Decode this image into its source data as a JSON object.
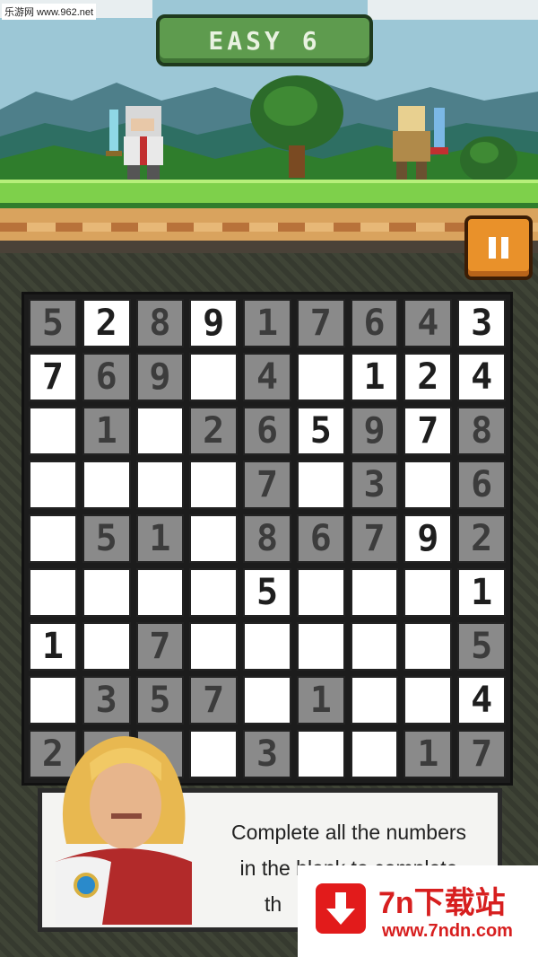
{
  "header": {
    "title": "EASY 6",
    "pause_icon": "pause-icon"
  },
  "watermark": {
    "top_left": "乐游网 www.962.net",
    "badge_main": "7n下载站",
    "badge_sub": "www.7ndn.com",
    "badge_icon": "download-icon"
  },
  "board": {
    "rows": [
      [
        {
          "v": "5",
          "g": true
        },
        {
          "v": "2",
          "g": false
        },
        {
          "v": "8",
          "g": true
        },
        {
          "v": "9",
          "g": false
        },
        {
          "v": "1",
          "g": true
        },
        {
          "v": "7",
          "g": true
        },
        {
          "v": "6",
          "g": true
        },
        {
          "v": "4",
          "g": true
        },
        {
          "v": "3",
          "g": false
        }
      ],
      [
        {
          "v": "7",
          "g": false
        },
        {
          "v": "6",
          "g": true
        },
        {
          "v": "9",
          "g": true
        },
        {
          "v": "",
          "g": false
        },
        {
          "v": "4",
          "g": true
        },
        {
          "v": "",
          "g": false
        },
        {
          "v": "1",
          "g": false
        },
        {
          "v": "2",
          "g": false
        },
        {
          "v": "4",
          "g": false
        }
      ],
      [
        {
          "v": "",
          "g": false
        },
        {
          "v": "1",
          "g": true
        },
        {
          "v": "",
          "g": false
        },
        {
          "v": "2",
          "g": true
        },
        {
          "v": "6",
          "g": true
        },
        {
          "v": "5",
          "g": false
        },
        {
          "v": "9",
          "g": true
        },
        {
          "v": "7",
          "g": false
        },
        {
          "v": "8",
          "g": true
        }
      ],
      [
        {
          "v": "",
          "g": false
        },
        {
          "v": "",
          "g": false
        },
        {
          "v": "",
          "g": false
        },
        {
          "v": "",
          "g": false
        },
        {
          "v": "7",
          "g": true
        },
        {
          "v": "",
          "g": false
        },
        {
          "v": "3",
          "g": true
        },
        {
          "v": "",
          "g": false
        },
        {
          "v": "6",
          "g": true
        }
      ],
      [
        {
          "v": "",
          "g": false
        },
        {
          "v": "5",
          "g": true
        },
        {
          "v": "1",
          "g": true
        },
        {
          "v": "",
          "g": false
        },
        {
          "v": "8",
          "g": true
        },
        {
          "v": "6",
          "g": true
        },
        {
          "v": "7",
          "g": true
        },
        {
          "v": "9",
          "g": false
        },
        {
          "v": "2",
          "g": true
        }
      ],
      [
        {
          "v": "",
          "g": false
        },
        {
          "v": "",
          "g": false
        },
        {
          "v": "",
          "g": false
        },
        {
          "v": "",
          "g": false
        },
        {
          "v": "5",
          "g": false
        },
        {
          "v": "",
          "g": false
        },
        {
          "v": "",
          "g": false
        },
        {
          "v": "",
          "g": false
        },
        {
          "v": "1",
          "g": false
        }
      ],
      [
        {
          "v": "1",
          "g": false
        },
        {
          "v": "",
          "g": false
        },
        {
          "v": "7",
          "g": true
        },
        {
          "v": "",
          "g": false
        },
        {
          "v": "",
          "g": false
        },
        {
          "v": "",
          "g": false
        },
        {
          "v": "",
          "g": false
        },
        {
          "v": "",
          "g": false
        },
        {
          "v": "5",
          "g": true
        }
      ],
      [
        {
          "v": "",
          "g": false
        },
        {
          "v": "3",
          "g": true
        },
        {
          "v": "5",
          "g": true
        },
        {
          "v": "7",
          "g": true
        },
        {
          "v": "",
          "g": false
        },
        {
          "v": "1",
          "g": true
        },
        {
          "v": "",
          "g": false
        },
        {
          "v": "",
          "g": false
        },
        {
          "v": "4",
          "g": false
        }
      ],
      [
        {
          "v": "2",
          "g": true
        },
        {
          "v": "",
          "g": true
        },
        {
          "v": "",
          "g": true
        },
        {
          "v": "",
          "g": false
        },
        {
          "v": "3",
          "g": true
        },
        {
          "v": "",
          "g": false
        },
        {
          "v": "",
          "g": false
        },
        {
          "v": "1",
          "g": true
        },
        {
          "v": "7",
          "g": true
        }
      ]
    ]
  },
  "dialog": {
    "lines": [
      "Complete all the numbers",
      "in the blank to complete",
      "th"
    ]
  }
}
